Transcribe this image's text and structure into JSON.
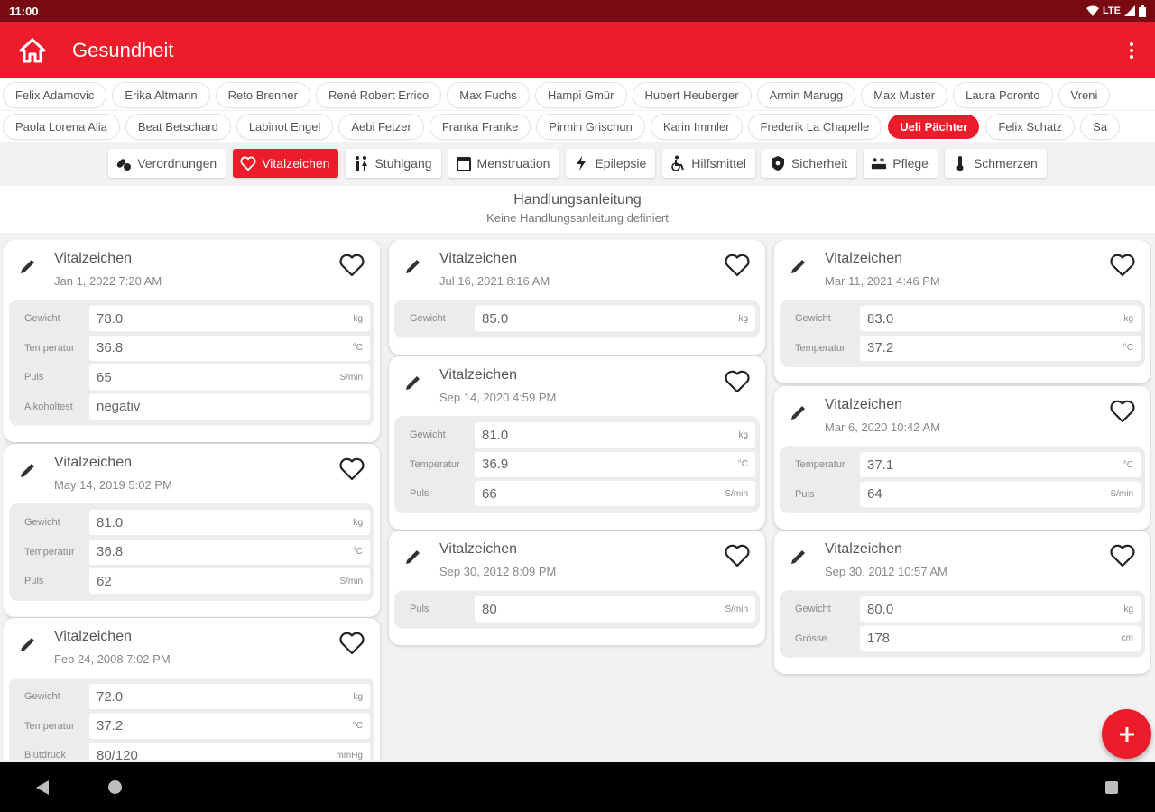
{
  "status": {
    "time": "11:00",
    "network": "LTE"
  },
  "app": {
    "title": "Gesundheit"
  },
  "persons_row1": [
    "Felix Adamovic",
    "Erika Altmann",
    "Reto Brenner",
    "René Robert Errico",
    "Max Fuchs",
    "Hampi Gmür",
    "Hubert Heuberger",
    "Armin Marugg",
    "Max Muster",
    "Laura Poronto",
    "Vreni"
  ],
  "persons_row2": [
    "Paola Lorena Alia",
    "Beat Betschard",
    "Labinot Engel",
    "Aebi Fetzer",
    "Franka Franke",
    "Pirmin Grischun",
    "Karin Immler",
    "Frederik La Chapelle",
    "Ueli Pächter",
    "Felix Schatz",
    "Sa"
  ],
  "selected_person": "Ueli Pächter",
  "categories": [
    {
      "label": "Verordnungen",
      "icon": "pills-icon"
    },
    {
      "label": "Vitalzeichen",
      "icon": "heart-icon",
      "active": true
    },
    {
      "label": "Stuhlgang",
      "icon": "restroom-icon"
    },
    {
      "label": "Menstruation",
      "icon": "calendar-icon"
    },
    {
      "label": "Epilepsie",
      "icon": "lightning-icon"
    },
    {
      "label": "Hilfsmittel",
      "icon": "wheelchair-icon"
    },
    {
      "label": "Sicherheit",
      "icon": "shield-icon"
    },
    {
      "label": "Pflege",
      "icon": "bath-icon"
    },
    {
      "label": "Schmerzen",
      "icon": "thermometer-icon"
    }
  ],
  "instructions": {
    "title": "Handlungsanleitung",
    "text": "Keine Handlungsanleitung definiert"
  },
  "records": [
    {
      "title": "Vitalzeichen",
      "date": "Jan 1, 2022 7:20 AM",
      "rows": [
        {
          "label": "Gewicht",
          "value": "78.0",
          "unit": "kg"
        },
        {
          "label": "Temperatur",
          "value": "36.8",
          "unit": "°C"
        },
        {
          "label": "Puls",
          "value": "65",
          "unit": "S/min"
        },
        {
          "label": "Alkoholtest",
          "value": "negativ",
          "unit": ""
        }
      ]
    },
    {
      "title": "Vitalzeichen",
      "date": "May 14, 2019 5:02 PM",
      "rows": [
        {
          "label": "Gewicht",
          "value": "81.0",
          "unit": "kg"
        },
        {
          "label": "Temperatur",
          "value": "36.8",
          "unit": "°C"
        },
        {
          "label": "Puls",
          "value": "62",
          "unit": "S/min"
        }
      ]
    },
    {
      "title": "Vitalzeichen",
      "date": "Feb 24, 2008 7:02 PM",
      "rows": [
        {
          "label": "Gewicht",
          "value": "72.0",
          "unit": "kg"
        },
        {
          "label": "Temperatur",
          "value": "37.2",
          "unit": "°C"
        },
        {
          "label": "Blutdruck",
          "value": "80/120",
          "unit": "mmHg"
        }
      ]
    },
    {
      "title": "Vitalzeichen",
      "date": "Jul 16, 2021 8:16 AM",
      "rows": [
        {
          "label": "Gewicht",
          "value": "85.0",
          "unit": "kg"
        }
      ]
    },
    {
      "title": "Vitalzeichen",
      "date": "Sep 14, 2020 4:59 PM",
      "rows": [
        {
          "label": "Gewicht",
          "value": "81.0",
          "unit": "kg"
        },
        {
          "label": "Temperatur",
          "value": "36.9",
          "unit": "°C"
        },
        {
          "label": "Puls",
          "value": "66",
          "unit": "S/min"
        }
      ]
    },
    {
      "title": "Vitalzeichen",
      "date": "Sep 30, 2012 8:09 PM",
      "rows": [
        {
          "label": "Puls",
          "value": "80",
          "unit": "S/min"
        }
      ]
    },
    {
      "title": "Vitalzeichen",
      "date": "Mar 11, 2021 4:46 PM",
      "rows": [
        {
          "label": "Gewicht",
          "value": "83.0",
          "unit": "kg"
        },
        {
          "label": "Temperatur",
          "value": "37.2",
          "unit": "°C"
        }
      ]
    },
    {
      "title": "Vitalzeichen",
      "date": "Mar 6, 2020 10:42 AM",
      "rows": [
        {
          "label": "Temperatur",
          "value": "37.1",
          "unit": "°C"
        },
        {
          "label": "Puls",
          "value": "64",
          "unit": "S/min"
        }
      ]
    },
    {
      "title": "Vitalzeichen",
      "date": "Sep 30, 2012 10:57 AM",
      "rows": [
        {
          "label": "Gewicht",
          "value": "80.0",
          "unit": "kg"
        },
        {
          "label": "Grösse",
          "value": "178",
          "unit": "cm"
        }
      ]
    }
  ],
  "colors": {
    "primary": "#ec1c2a",
    "status_bar": "#7a0a12"
  }
}
